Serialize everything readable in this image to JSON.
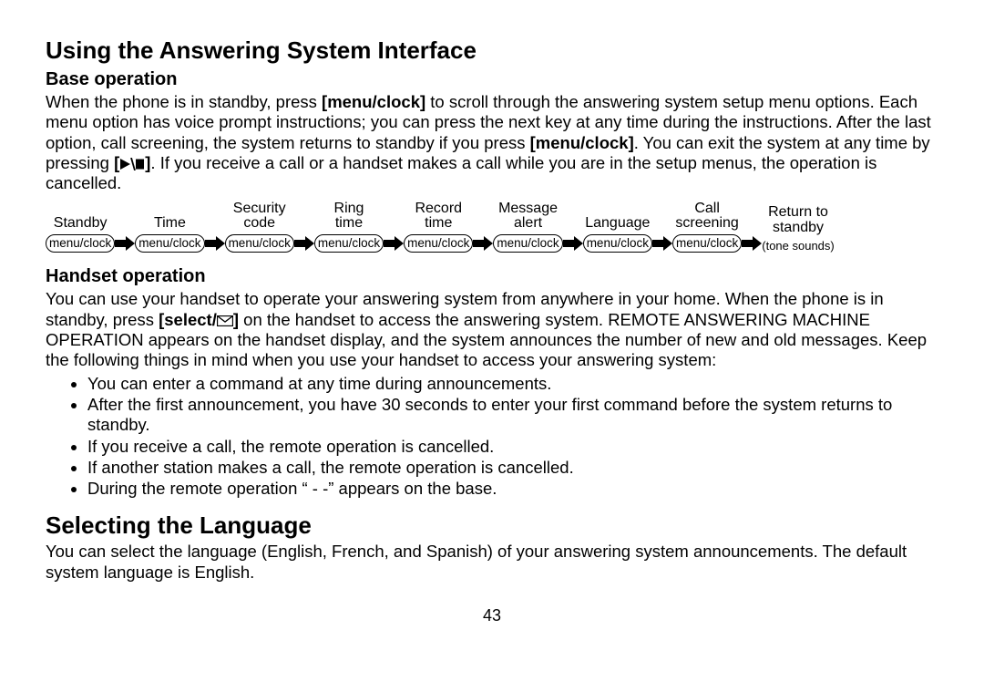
{
  "heading1": "Using the Answering System Interface",
  "base_op_heading": "Base operation",
  "base_op_p1_a": "When the phone is in standby, press ",
  "base_op_p1_b": "[menu/clock]",
  "base_op_p1_c": " to scroll through the answering system setup menu options. Each menu option has voice prompt instructions; you can press the next key at any time during the instructions. After the last option, call screening, the system returns to standby if you press ",
  "base_op_p1_d": "[menu/clock]",
  "base_op_p1_e": ". You can exit the system at any time by pressing ",
  "base_op_p1_f": ". If you receive a call or a handset makes a call while you are in the setup menus, the operation is cancelled.",
  "flow": {
    "button_label": "menu/clock",
    "steps": [
      {
        "l1": "",
        "l2": "Standby"
      },
      {
        "l1": "",
        "l2": "Time"
      },
      {
        "l1": "Security",
        "l2": "code"
      },
      {
        "l1": "Ring",
        "l2": "time"
      },
      {
        "l1": "Record",
        "l2": "time"
      },
      {
        "l1": "Message",
        "l2": "alert"
      },
      {
        "l1": "",
        "l2": "Language"
      },
      {
        "l1": "Call",
        "l2": "screening"
      }
    ],
    "final": {
      "l1": "Return to",
      "l2": "standby",
      "l3": "(tone sounds)"
    }
  },
  "handset_heading": "Handset operation",
  "handset_p1_a": "You can use your handset to operate your answering system from anywhere in your home. When the phone is in standby, press ",
  "handset_p1_b": "[select/",
  "handset_p1_c": "]",
  "handset_p1_d": " on the handset to access the answering system. REMOTE ANSWERING MACHINE OPERATION appears on the handset display, and the system announces the number of new and old messages. Keep the following things in mind when you use your handset to access your answering system:",
  "bullets": [
    "You can enter a command at any time during announcements.",
    "After the first announcement, you have 30 seconds to enter your first command before the system returns to standby.",
    "If you receive a call, the remote operation is cancelled.",
    "If another station makes a call, the remote operation is cancelled.",
    "During the remote operation “ - -” appears on the base."
  ],
  "heading2": "Selecting the Language",
  "lang_p": "You can select the language (English, French, and Spanish) of your answering system announcements. The default system language is English.",
  "page_number": "43"
}
